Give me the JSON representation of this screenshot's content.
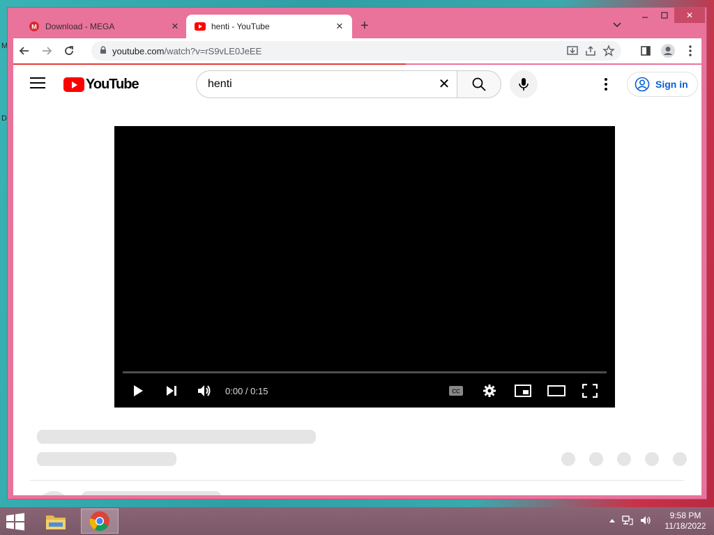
{
  "desktop": {
    "edge_labels": [
      "M",
      "D"
    ]
  },
  "browser": {
    "tabs": [
      {
        "title": "Download - MEGA",
        "favicon": "mega-icon",
        "active": false
      },
      {
        "title": "henti - YouTube",
        "favicon": "youtube-icon",
        "active": true
      }
    ],
    "new_tab": "+",
    "url_host": "youtube.com",
    "url_path": "/watch?v=rS9vLE0JeEE"
  },
  "youtube": {
    "logo_text": "YouTube",
    "search_value": "henti",
    "sign_in_label": "Sign in"
  },
  "player": {
    "time": "0:00 / 0:15",
    "progress": 0
  },
  "taskbar": {
    "time": "9:58 PM",
    "date": "11/18/2022"
  },
  "colors": {
    "accent_red": "#ff0000",
    "link_blue": "#065fd4",
    "window_frame": "#e9739b"
  }
}
